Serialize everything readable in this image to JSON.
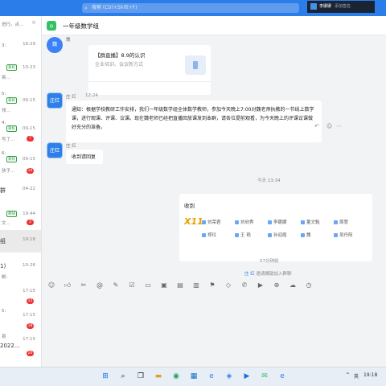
{
  "titlebar": {
    "search_placeholder": "搜索 (Ctrl+Shift+F)",
    "user_name": "李娜娜",
    "user_status": "添加签名",
    "minimize": "—",
    "maximize": "□",
    "close": "×"
  },
  "sidebar": {
    "items": [
      {
        "name": "",
        "preview": "进行。点...",
        "time": "",
        "badge": ""
      },
      {
        "name": "",
        "preview": "",
        "time": "16:29",
        "badge": ""
      },
      {
        "name": "",
        "preview": "",
        "time": "10-23",
        "badge": "",
        "tag": "家校"
      },
      {
        "name": "",
        "preview": "英...",
        "time": "",
        "badge": ""
      },
      {
        "name": "",
        "preview": "",
        "time": "09-15",
        "badge": "",
        "tag": "家校"
      },
      {
        "name": "",
        "preview": "领...",
        "time": "",
        "badge": ""
      },
      {
        "name": "",
        "preview": "",
        "time": "09-15",
        "badge": "",
        "tag": "家校"
      },
      {
        "name": "",
        "preview": "写了...",
        "time": "",
        "badge": "7"
      },
      {
        "name": "",
        "preview": "",
        "time": "09-15",
        "badge": "",
        "tag": "家校"
      },
      {
        "name": "",
        "preview": "孩子...",
        "time": "",
        "badge": "10"
      },
      {
        "name": "群",
        "preview": "",
        "time": "04-22",
        "badge": ""
      },
      {
        "name": "",
        "preview": "",
        "time": "19:44",
        "badge": "",
        "tag": "教研"
      },
      {
        "name": "",
        "preview": "文...",
        "time": "",
        "badge": "2"
      },
      {
        "name": "组",
        "preview": "",
        "time": "19:18",
        "badge": "",
        "selected": true
      },
      {
        "name": "1)",
        "preview": "",
        "time": "10-26",
        "badge": ""
      },
      {
        "name": "",
        "preview": "",
        "time": "17:15",
        "badge": "15"
      },
      {
        "name": "",
        "preview": "",
        "time": "17:15",
        "badge": "18"
      },
      {
        "name": "2022...",
        "preview": "",
        "time": "17:15",
        "badge": "20"
      }
    ],
    "preview_extra": [
      "3:",
      "5:",
      "4:",
      "6:",
      "邮:",
      "5:",
      "县"
    ]
  },
  "chat": {
    "group_name": "一年级数学组",
    "messages": {
      "m1": {
        "sender": "魏",
        "avatar_text": "魏",
        "card_title": "【群直播】8.9的认识",
        "card_source": "企业培训、会议新方式"
      },
      "m2": {
        "sender": "庄 红",
        "time": "12:24",
        "avatar_text": "庄红",
        "text": "通知：根据学校教研工作安排，我们一年级数学组全体数学教师，参加今天晚上7:00对魏老师执教的一节线上数学课，进行观课、评课、议课。现在魏老师已经把直播回放课发到本群，请各位提前观看，为今天晚上的评课议课做好充分的准备。"
      },
      "m3": {
        "sender": "庄 红",
        "avatar_text": "庄红",
        "text": "收到请回复"
      },
      "time_divider": "今天 13:34",
      "m4": {
        "title": "收到",
        "count": "X11",
        "names": [
          "刘荣君",
          "刘欣秀",
          "李娜娜",
          "董文魁",
          "周慧",
          "郑玲",
          "王 艳",
          "孙迎霞",
          "魏",
          "吴丹阳"
        ]
      },
      "time_divider2": "57分钟前",
      "join_notice": {
        "actor": "庄 红",
        "text": " 邀请魏歆加入群聊"
      }
    }
  },
  "toolbar_icons": [
    "emoji-icon",
    "like-icon",
    "scissors-icon",
    "mention-icon",
    "edit-icon",
    "task-icon",
    "folder-icon",
    "image-icon",
    "doc-icon",
    "chart-icon",
    "vote-icon",
    "message-icon",
    "phone-icon",
    "video-icon",
    "plus-icon",
    "cloud-icon",
    "history-icon"
  ],
  "taskbar": {
    "lang": "英",
    "time": "19:18"
  }
}
